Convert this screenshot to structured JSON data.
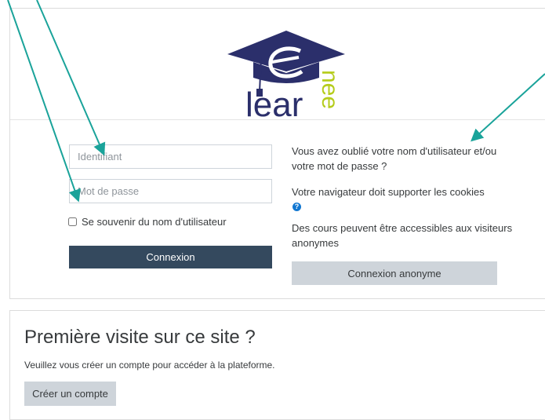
{
  "logo": {
    "text": "lear",
    "swirl_text": "nee"
  },
  "login": {
    "username_placeholder": "Identifiant",
    "password_placeholder": "Mot de passe",
    "remember_label": "Se souvenir du nom d'utilisateur",
    "login_button": "Connexion"
  },
  "info": {
    "forgot_link": "Vous avez oublié votre nom d'utilisateur et/ou votre mot de passe ?",
    "cookies_text": "Votre navigateur doit supporter les cookies",
    "guest_text": "Des cours peuvent être accessibles aux visiteurs anonymes",
    "guest_button": "Connexion anonyme"
  },
  "signup": {
    "title": "Première visite sur ce site ?",
    "description": "Veuillez vous créer un compte pour accéder à la plateforme.",
    "button": "Créer un compte"
  },
  "colors": {
    "navy": "#2b2f6b",
    "lime": "#b5cc1b",
    "primary_button": "#34495e",
    "secondary_button": "#ced4da",
    "arrow": "#1aa39a",
    "help_icon": "#1177d1"
  },
  "icons": [
    "mortarboard-icon",
    "help-icon",
    "arrow-icon"
  ]
}
